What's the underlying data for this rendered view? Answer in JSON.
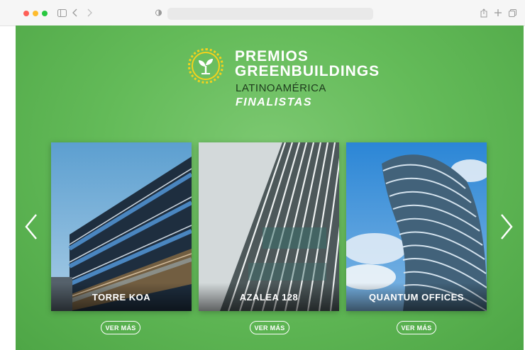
{
  "browser": {
    "icons": [
      "sidebar-icon",
      "back-icon",
      "forward-icon",
      "shield-icon",
      "share-icon",
      "new-tab-icon",
      "tabs-icon"
    ]
  },
  "header": {
    "title_line1": "PREMIOS",
    "title_line2": "GREENBUILDINGS",
    "subtitle": "LATINOAMÉRICA",
    "section": "FINALISTAS"
  },
  "carousel": {
    "cards": [
      {
        "label": "TORRE KOA",
        "button": "VER MÁS"
      },
      {
        "label": "AZALEA 128",
        "button": "VER MÁS"
      },
      {
        "label": "QUANTUM OFFICES",
        "button": "VER MÁS"
      }
    ]
  },
  "colors": {
    "background": "#64bb59",
    "logo": "#f4d21c",
    "subtitle": "#1d3a1c"
  }
}
